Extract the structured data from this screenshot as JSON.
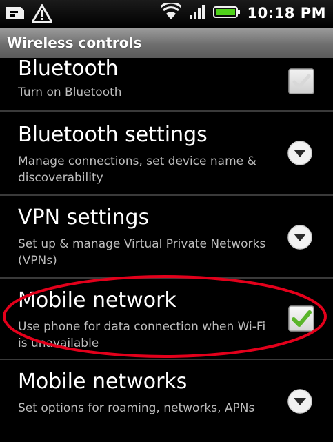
{
  "status_bar": {
    "time": "10:18 PM",
    "icons": [
      "sim-card-icon",
      "warning-icon",
      "wifi-icon",
      "signal-icon",
      "battery-icon"
    ]
  },
  "title_bar": {
    "title": "Wireless controls"
  },
  "items": [
    {
      "title": "Bluetooth",
      "summary": "Turn on Bluetooth",
      "widget": "checkbox",
      "checked": false,
      "enabled": false
    },
    {
      "title": "Bluetooth settings",
      "summary": "Manage connections, set device name & discoverability",
      "widget": "chevron"
    },
    {
      "title": "VPN settings",
      "summary": "Set up & manage Virtual Private Networks (VPNs)",
      "widget": "chevron"
    },
    {
      "title": "Mobile network",
      "summary": "Use phone for data connection when Wi-Fi is unavailable",
      "widget": "checkbox",
      "checked": true,
      "enabled": true
    },
    {
      "title": "Mobile networks",
      "summary": "Set options for roaming, networks, APNs",
      "widget": "chevron"
    }
  ],
  "colors": {
    "checkmark": "#5ab52a",
    "highlight_ellipse": "#e3001b",
    "title_bar": "#7a7a7a"
  }
}
